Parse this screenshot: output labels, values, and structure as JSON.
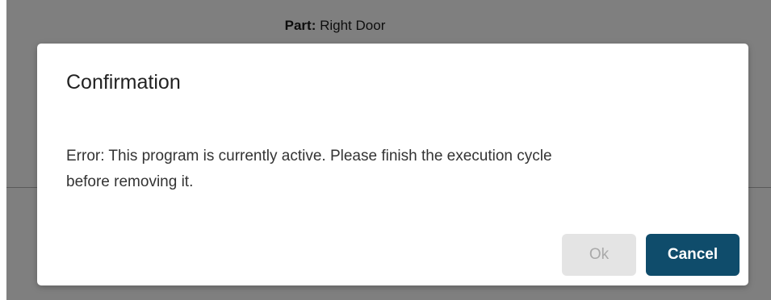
{
  "background": {
    "part_label": "Part:",
    "part_value": "Right Door"
  },
  "dialog": {
    "title": "Confirmation",
    "message_line1": "Error: This program is currently active. Please finish the execution cycle",
    "message_line2": "before removing it.",
    "ok_label": "Ok",
    "cancel_label": "Cancel"
  },
  "colors": {
    "accent": "#0f4c6b",
    "disabled_button_bg": "#e4e4e4",
    "disabled_button_text": "#a9a9a9",
    "backdrop": "rgba(0,0,0,0.5)"
  }
}
